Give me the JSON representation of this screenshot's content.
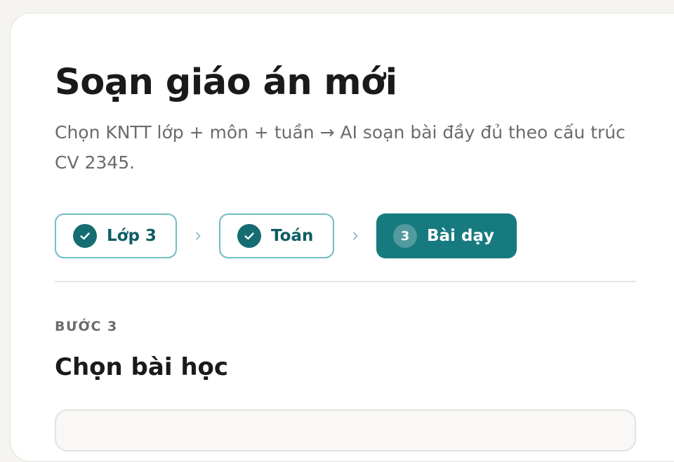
{
  "header": {
    "title": "Soạn giáo án mới",
    "subtitle": "Chọn KNTT lớp + môn + tuần → AI soạn bài đầy đủ theo cấu trúc CV 2345."
  },
  "steps": [
    {
      "label": "Lớp 3",
      "status": "done",
      "icon": "check-icon"
    },
    {
      "label": "Toán",
      "status": "done",
      "icon": "check-icon"
    },
    {
      "number": "3",
      "label": "Bài dạy",
      "status": "active"
    }
  ],
  "section": {
    "eyebrow": "BƯỚC 3",
    "title": "Chọn bài học"
  },
  "colors": {
    "accent": "#177a7f",
    "accent_border": "#72bdc4",
    "text_primary": "#1a1a1a",
    "text_muted": "#6b6b6b"
  }
}
